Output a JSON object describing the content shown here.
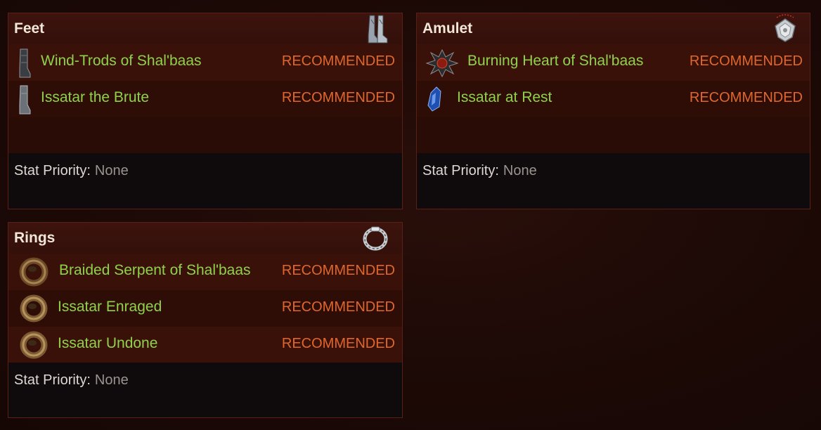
{
  "panels": {
    "feet": {
      "title": "Feet",
      "slot_icon": "boots-icon",
      "items": [
        {
          "name": "Wind-Trods of Shal'baas",
          "status": "RECOMMENDED",
          "icon": "boot-item-icon"
        },
        {
          "name": "Issatar the Brute",
          "status": "RECOMMENDED",
          "icon": "boot-item-icon"
        }
      ],
      "stat_label": "Stat Priority:",
      "stat_value": "None"
    },
    "amulet": {
      "title": "Amulet",
      "slot_icon": "amulet-icon",
      "items": [
        {
          "name": "Burning Heart of Shal'baas",
          "status": "RECOMMENDED",
          "icon": "spiked-amulet-icon"
        },
        {
          "name": "Issatar at Rest",
          "status": "RECOMMENDED",
          "icon": "blue-gem-icon"
        }
      ],
      "stat_label": "Stat Priority:",
      "stat_value": "None"
    },
    "rings": {
      "title": "Rings",
      "slot_icon": "ring-icon",
      "items": [
        {
          "name": "Braided Serpent of Shal'baas",
          "status": "RECOMMENDED",
          "icon": "bronze-ring-icon"
        },
        {
          "name": "Issatar Enraged",
          "status": "RECOMMENDED",
          "icon": "bronze-ring-icon"
        },
        {
          "name": "Issatar Undone",
          "status": "RECOMMENDED",
          "icon": "bronze-ring-icon"
        }
      ],
      "stat_label": "Stat Priority:",
      "stat_value": "None"
    }
  },
  "colors": {
    "item_name": "#8fd24a",
    "status": "#e0672c",
    "title": "#f2e6d6",
    "stat_label": "#ded9d4",
    "stat_value": "#9a948e"
  }
}
